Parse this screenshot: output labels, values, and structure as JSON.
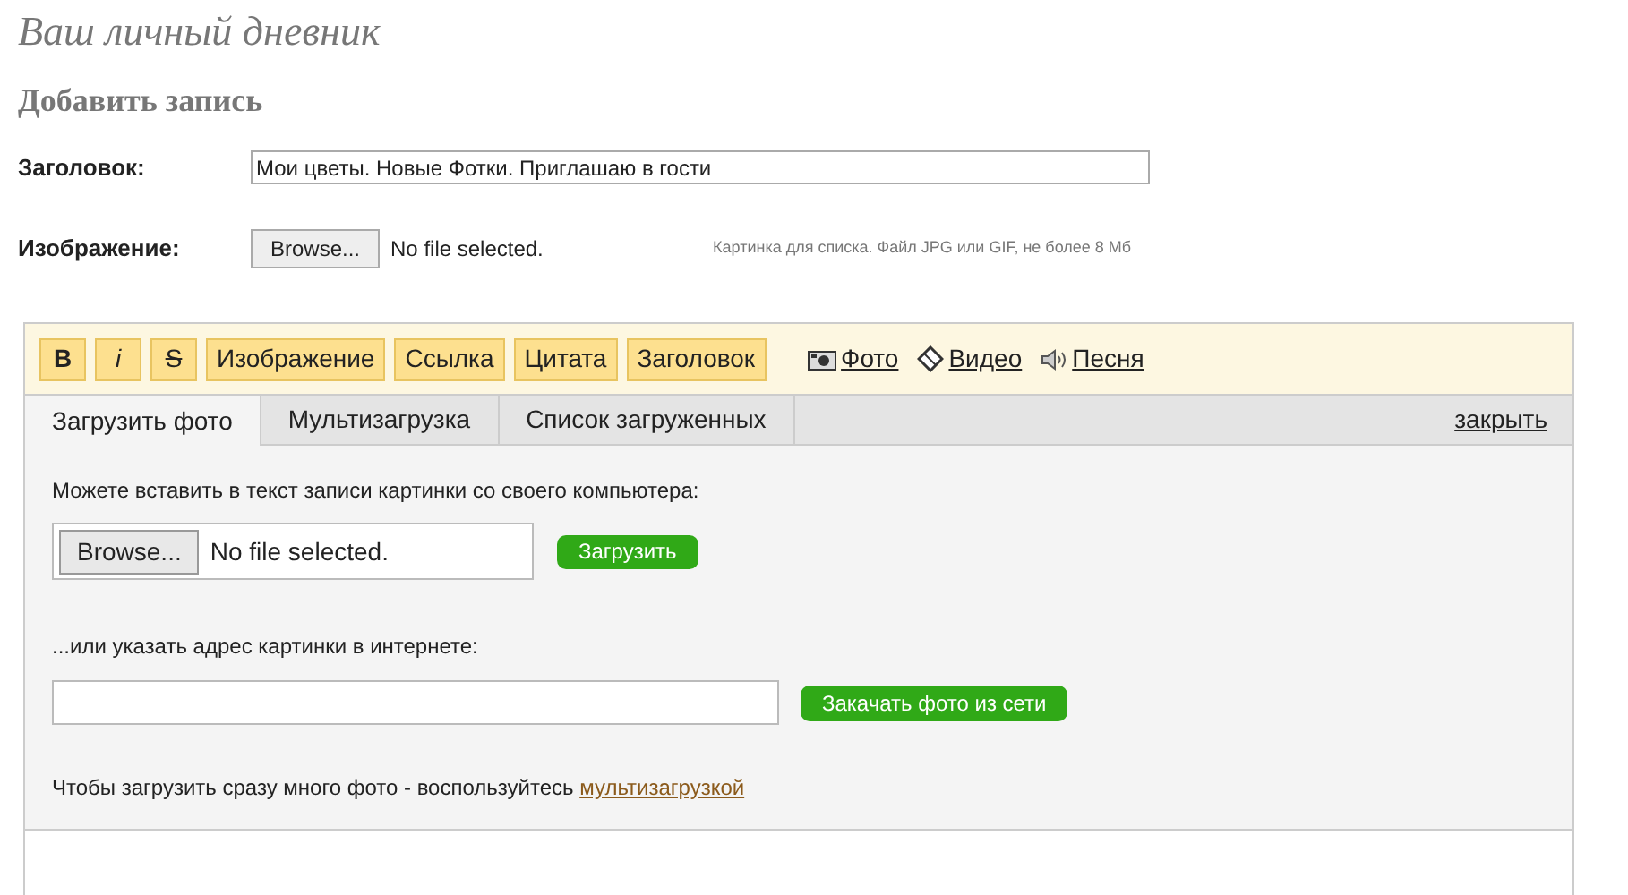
{
  "page_title": "Ваш личный дневник",
  "section_title": "Добавить запись",
  "title_field": {
    "label": "Заголовок:",
    "value": "Мои цветы. Новые Фотки. Приглашаю в гости"
  },
  "image_field": {
    "label": "Изображение:",
    "button": "Browse...",
    "status": "No file selected.",
    "hint": "Картинка для списка. Файл JPG или GIF, не более 8 Мб"
  },
  "toolbar": {
    "buttons": [
      {
        "label": "B",
        "kind": "bold"
      },
      {
        "label": "i",
        "kind": "italic"
      },
      {
        "label": "S",
        "kind": "strike"
      },
      {
        "label": "Изображение",
        "kind": "plain"
      },
      {
        "label": "Ссылка",
        "kind": "plain"
      },
      {
        "label": "Цитата",
        "kind": "plain"
      },
      {
        "label": "Заголовок",
        "kind": "plain"
      }
    ],
    "media": [
      {
        "label": "Фото",
        "kind": "camera"
      },
      {
        "label": "Видео",
        "kind": "diamond"
      },
      {
        "label": "Песня",
        "kind": "speaker"
      }
    ]
  },
  "tabs": [
    {
      "label": "Загрузить фото",
      "selected": true
    },
    {
      "label": "Мультизагрузка",
      "selected": false
    },
    {
      "label": "Список загруженных",
      "selected": false
    }
  ],
  "close_link": "закрыть",
  "upload": {
    "intro": "Можете вставить в текст записи картинки со своего компьютера:",
    "button": "Browse...",
    "status": "No file selected.",
    "submit": "Загрузить"
  },
  "url_upload": {
    "intro": "...или указать адрес картинки в интернете:",
    "submit": "Закачать фото из сети"
  },
  "footer": {
    "text": "Чтобы загрузить сразу много фото - воспользуйтесь ",
    "link": "мультизагрузкой"
  }
}
